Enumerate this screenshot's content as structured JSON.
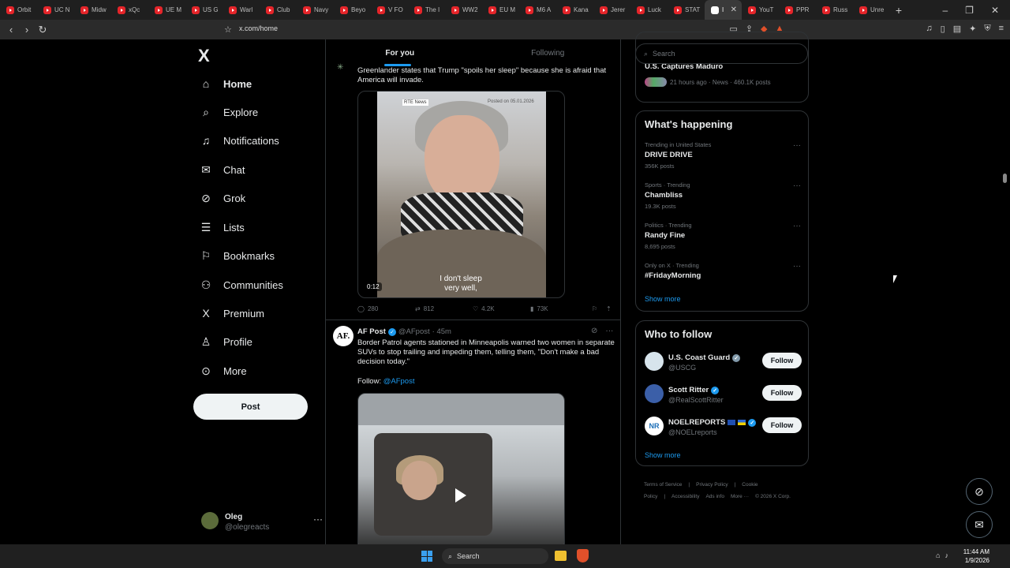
{
  "browser": {
    "tabs": [
      "Orbit",
      "UC N",
      "Midw",
      "xQc",
      "UE M",
      "US G",
      "Warl",
      "Club",
      "Navy",
      "Beyo",
      "V FO",
      "The I",
      "WW2",
      "EU M",
      "M6 A",
      "Kana",
      "Jerer",
      "Luck",
      "STAT",
      "",
      "YouT",
      "PPR",
      "Russ",
      "Unre"
    ],
    "active_tab_index": 19,
    "active_tab_label": "I",
    "url": "x.com/home",
    "new_tab": "+",
    "win_min": "–",
    "win_max": "❐",
    "win_close": "✕"
  },
  "nav": {
    "logo": "X",
    "items": [
      {
        "label": "Home",
        "icon": "home-icon"
      },
      {
        "label": "Explore",
        "icon": "search-icon"
      },
      {
        "label": "Notifications",
        "icon": "bell-icon"
      },
      {
        "label": "Chat",
        "icon": "mail-icon"
      },
      {
        "label": "Grok",
        "icon": "grok-icon"
      },
      {
        "label": "Lists",
        "icon": "list-icon"
      },
      {
        "label": "Bookmarks",
        "icon": "bookmark-icon"
      },
      {
        "label": "Communities",
        "icon": "people-icon"
      },
      {
        "label": "Premium",
        "icon": "x-icon"
      },
      {
        "label": "Profile",
        "icon": "person-icon"
      },
      {
        "label": "More",
        "icon": "more-circle-icon"
      }
    ],
    "post_label": "Post",
    "account": {
      "name": "Oleg",
      "handle": "@olegreacts",
      "dots": "···"
    }
  },
  "main": {
    "tabs": [
      "For you",
      "Following"
    ],
    "tweet1": {
      "text": "Greenlander states that Trump \"spoils her sleep\" because she is afraid that America will invade.",
      "video_badge": "RTE News",
      "video_posted": "Posted on 05.01.2026",
      "subtitle_1": "I don't sleep",
      "subtitle_2": "very well,",
      "duration": "0:12",
      "replies": "280",
      "reposts": "812",
      "likes": "4.2K",
      "views": "73K"
    },
    "tweet2": {
      "avatar_text": "AF.",
      "name": "AF Post",
      "handle": "@AFpost",
      "time": "· 45m",
      "text": "Border Patrol agents stationed in Minneapolis warned two women in separate SUVs to stop trailing and impeding them, telling them, \"Don't make a bad decision today.\"",
      "follow_prefix": "Follow: ",
      "follow_link": "@AFpost"
    }
  },
  "right": {
    "search_placeholder": "Search",
    "news": {
      "title": "Venezuela Releases Political Prisoners After U.S. Captures Maduro",
      "meta": "21 hours ago · News · 460.1K posts"
    },
    "happening": {
      "heading": "What's happening",
      "trends": [
        {
          "context": "Trending in United States",
          "title": "DRIVE DRIVE",
          "count": "356K posts"
        },
        {
          "context": "Sports · Trending",
          "title": "Chambliss",
          "count": "19.3K posts"
        },
        {
          "context": "Politics · Trending",
          "title": "Randy Fine",
          "count": "8,695 posts"
        },
        {
          "context": "Only on X · Trending",
          "title": "#FridayMorning",
          "count": ""
        }
      ],
      "more_dots": "···",
      "show_more": "Show more"
    },
    "who_to_follow": {
      "heading": "Who to follow",
      "accounts": [
        {
          "name": "U.S. Coast Guard",
          "handle": "@USCG",
          "avatar_color": "#d7e4ec"
        },
        {
          "name": "Scott Ritter",
          "handle": "@RealScottRitter",
          "avatar_color": "#3b5fa8"
        },
        {
          "name": "NOELREPORTS",
          "handle": "@NOELreports",
          "avatar_color": "#ffffff",
          "avatar_text": "NR"
        }
      ],
      "follow_label": "Follow",
      "show_more": "Show more"
    },
    "footer": [
      "Terms of Service",
      "|",
      "Privacy Policy",
      "|",
      "Cookie Policy",
      "|",
      "Accessibility",
      "Ads info",
      "More ···",
      "© 2026 X Corp."
    ]
  },
  "taskbar": {
    "search": "Search",
    "time": "11:44 AM",
    "date": "1/9/2026"
  },
  "colors": {
    "accent": "#1d9bf0",
    "background": "#000000",
    "border": "#2f3336",
    "muted": "#71767b"
  }
}
